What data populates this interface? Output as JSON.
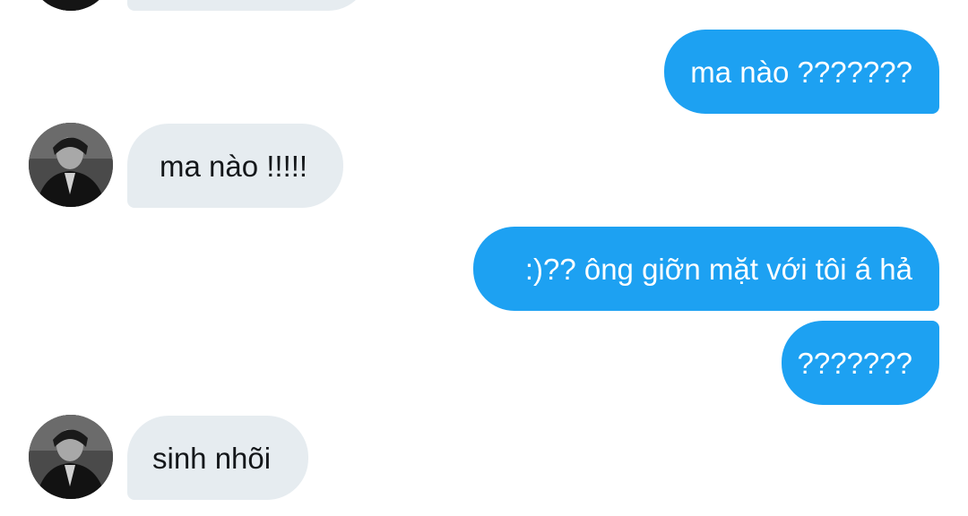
{
  "conversation": {
    "messages": [
      {
        "direction": "incoming",
        "text": ""
      },
      {
        "direction": "outgoing",
        "text": "ma nào ???????"
      },
      {
        "direction": "incoming",
        "text": "ma nào !!!!!"
      },
      {
        "direction": "outgoing",
        "text": ":)?? ông giỡn mặt với tôi á hả"
      },
      {
        "direction": "outgoing",
        "text": "???????"
      },
      {
        "direction": "incoming",
        "text": "sinh nhõi"
      }
    ]
  },
  "colors": {
    "outgoing_bubble": "#1da1f2",
    "incoming_bubble": "#e6ecf0",
    "outgoing_text": "#ffffff",
    "incoming_text": "#14171a"
  },
  "icons": {
    "avatar": "profile-photo-grayscale"
  }
}
